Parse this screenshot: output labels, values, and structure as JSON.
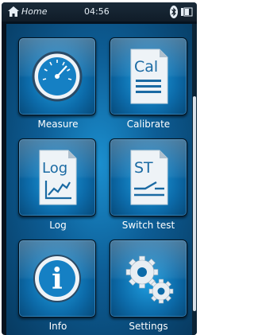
{
  "status_bar": {
    "home_label": "Home",
    "time": "04:56",
    "icons": [
      "home-icon",
      "bluetooth-icon",
      "battery-icon"
    ]
  },
  "menu": {
    "tiles": [
      {
        "label": "Measure",
        "icon": "gauge-icon"
      },
      {
        "label": "Calibrate",
        "icon": "calibrate-document-icon",
        "icon_text": "Cal"
      },
      {
        "label": "Log",
        "icon": "log-document-icon",
        "icon_text": "Log"
      },
      {
        "label": "Switch test",
        "icon": "switch-test-document-icon",
        "icon_text": "ST"
      },
      {
        "label": "Info",
        "icon": "info-icon",
        "icon_text": "i"
      },
      {
        "label": "Settings",
        "icon": "gears-icon"
      }
    ]
  },
  "colors": {
    "screen_blue": "#0d5d95",
    "tile_blue": "#1e9ee0",
    "bezel": "#06121e",
    "text": "#ffffff"
  }
}
